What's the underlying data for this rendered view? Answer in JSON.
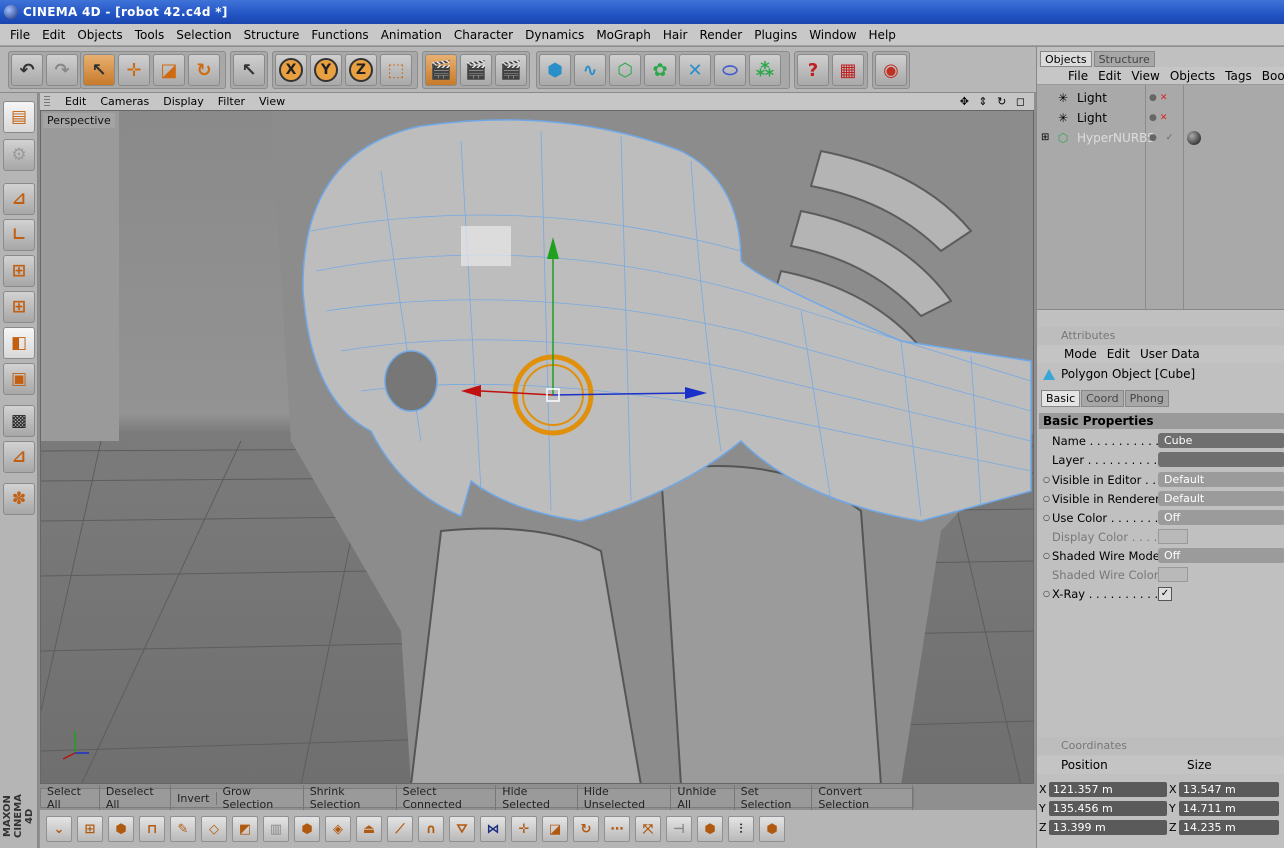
{
  "window": {
    "title": "CINEMA 4D - [robot 42.c4d *]"
  },
  "menu": [
    "File",
    "Edit",
    "Objects",
    "Tools",
    "Selection",
    "Structure",
    "Functions",
    "Animation",
    "Character",
    "Dynamics",
    "MoGraph",
    "Hair",
    "Render",
    "Plugins",
    "Window",
    "Help"
  ],
  "toolbar": {
    "undo": "undo-icon",
    "redo": "redo-icon",
    "live_select": "live-select-icon",
    "move": "move-icon",
    "scale": "scale-icon",
    "rotate": "rotate-icon",
    "x": "X",
    "y": "Y",
    "z": "Z"
  },
  "viewport": {
    "menu": [
      "Edit",
      "Cameras",
      "Display",
      "Filter",
      "View"
    ],
    "label": "Perspective",
    "nav_icons": "✥ ⇕ ↻ ◻"
  },
  "selection_bar": [
    "Select All",
    "Deselect All",
    "Invert",
    "Grow Selection",
    "Shrink Selection",
    "Select Connected",
    "Hide Selected",
    "Hide Unselected",
    "Unhide All",
    "Set Selection",
    "Convert Selection"
  ],
  "brand": "MAXON CINEMA 4D",
  "object_manager": {
    "tabs": [
      "Objects",
      "Structure"
    ],
    "menu": [
      "File",
      "Edit",
      "View",
      "Objects",
      "Tags",
      "Bookm"
    ],
    "objects": [
      {
        "name": "Light",
        "icon": "light-icon"
      },
      {
        "name": "Light",
        "icon": "light-icon"
      },
      {
        "name": "HyperNURBS",
        "icon": "hypernurbs-icon"
      }
    ]
  },
  "attributes": {
    "header": "Attributes",
    "menu": [
      "Mode",
      "Edit",
      "User Data"
    ],
    "object_title": "Polygon Object [Cube]",
    "tabs": [
      "Basic",
      "Coord",
      "Phong"
    ],
    "section": "Basic Properties",
    "props": [
      {
        "label": "Name . . . . . . . . . . . . .",
        "value": "Cube"
      },
      {
        "label": "Layer . . . . . . . . . . . .",
        "value": ""
      },
      {
        "label": "Visible in Editor . . . . .",
        "value": "Default"
      },
      {
        "label": "Visible in Renderer . . .",
        "value": "Default"
      },
      {
        "label": "Use Color . . . . . . . . . .",
        "value": "Off"
      },
      {
        "label": "Display Color . . . . . . .",
        "value": ""
      },
      {
        "label": "Shaded Wire Mode . . .",
        "value": "Off"
      },
      {
        "label": "Shaded Wire Color",
        "value": ""
      },
      {
        "label": "X-Ray . . . . . . . . . . . .",
        "value": ""
      }
    ]
  },
  "coordinates": {
    "header": "Coordinates",
    "col_position": "Position",
    "col_size": "Size",
    "rows": [
      {
        "axis": "X",
        "position": "121.357 m",
        "size": "13.547 m"
      },
      {
        "axis": "Y",
        "position": "135.456 m",
        "size": "14.711 m"
      },
      {
        "axis": "Z",
        "position": "13.399 m",
        "size": "14.235 m"
      }
    ]
  }
}
